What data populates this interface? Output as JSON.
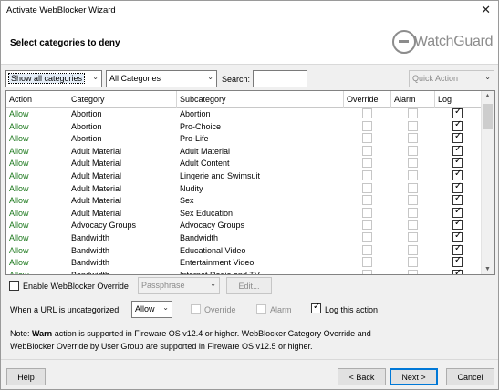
{
  "window": {
    "title": "Activate WebBlocker Wizard",
    "close_glyph": "✕"
  },
  "header": {
    "heading": "Select categories to deny",
    "logo_text": "WatchGuard"
  },
  "toolbar": {
    "filter_select": "Show all categories",
    "category_select": "All Categories",
    "search_label": "Search:",
    "search_value": "",
    "quick_action": "Quick Action"
  },
  "grid": {
    "columns": [
      "Action",
      "Category",
      "Subcategory",
      "Override",
      "Alarm",
      "Log"
    ],
    "rows": [
      {
        "action": "Allow",
        "category": "Abortion",
        "subcategory": "Abortion",
        "override": false,
        "alarm": false,
        "log": true
      },
      {
        "action": "Allow",
        "category": "Abortion",
        "subcategory": "Pro-Choice",
        "override": false,
        "alarm": false,
        "log": true
      },
      {
        "action": "Allow",
        "category": "Abortion",
        "subcategory": "Pro-Life",
        "override": false,
        "alarm": false,
        "log": true
      },
      {
        "action": "Allow",
        "category": "Adult Material",
        "subcategory": "Adult Material",
        "override": false,
        "alarm": false,
        "log": true
      },
      {
        "action": "Allow",
        "category": "Adult Material",
        "subcategory": "Adult Content",
        "override": false,
        "alarm": false,
        "log": true
      },
      {
        "action": "Allow",
        "category": "Adult Material",
        "subcategory": "Lingerie and Swimsuit",
        "override": false,
        "alarm": false,
        "log": true
      },
      {
        "action": "Allow",
        "category": "Adult Material",
        "subcategory": "Nudity",
        "override": false,
        "alarm": false,
        "log": true
      },
      {
        "action": "Allow",
        "category": "Adult Material",
        "subcategory": "Sex",
        "override": false,
        "alarm": false,
        "log": true
      },
      {
        "action": "Allow",
        "category": "Adult Material",
        "subcategory": "Sex Education",
        "override": false,
        "alarm": false,
        "log": true
      },
      {
        "action": "Allow",
        "category": "Advocacy Groups",
        "subcategory": "Advocacy Groups",
        "override": false,
        "alarm": false,
        "log": true
      },
      {
        "action": "Allow",
        "category": "Bandwidth",
        "subcategory": "Bandwidth",
        "override": false,
        "alarm": false,
        "log": true
      },
      {
        "action": "Allow",
        "category": "Bandwidth",
        "subcategory": "Educational Video",
        "override": false,
        "alarm": false,
        "log": true
      },
      {
        "action": "Allow",
        "category": "Bandwidth",
        "subcategory": "Entertainment Video",
        "override": false,
        "alarm": false,
        "log": true
      },
      {
        "action": "Allow",
        "category": "Bandwidth",
        "subcategory": "Internet Radio and TV",
        "override": false,
        "alarm": false,
        "log": true
      }
    ]
  },
  "override": {
    "enable_label": "Enable WebBlocker Override",
    "enable_checked": false,
    "mode_select": "Passphrase",
    "edit_button": "Edit..."
  },
  "uncategorized": {
    "label": "When a URL is uncategorized",
    "action_select": "Allow",
    "override_label": "Override",
    "override_checked": false,
    "alarm_label": "Alarm",
    "alarm_checked": false,
    "log_label": "Log this action",
    "log_checked": true
  },
  "note": {
    "prefix": "Note: ",
    "warn": "Warn",
    "line1_rest": " action is supported in Fireware OS v12.4 or higher. WebBlocker Category Override and",
    "line2": "WebBlocker Override by User Group are supported in Fireware OS v12.5 or higher."
  },
  "footer": {
    "help": "Help",
    "back": "< Back",
    "next": "Next >",
    "cancel": "Cancel"
  },
  "colors": {
    "allow_text": "#1f7a1f",
    "default_button_border": "#0078d7"
  }
}
